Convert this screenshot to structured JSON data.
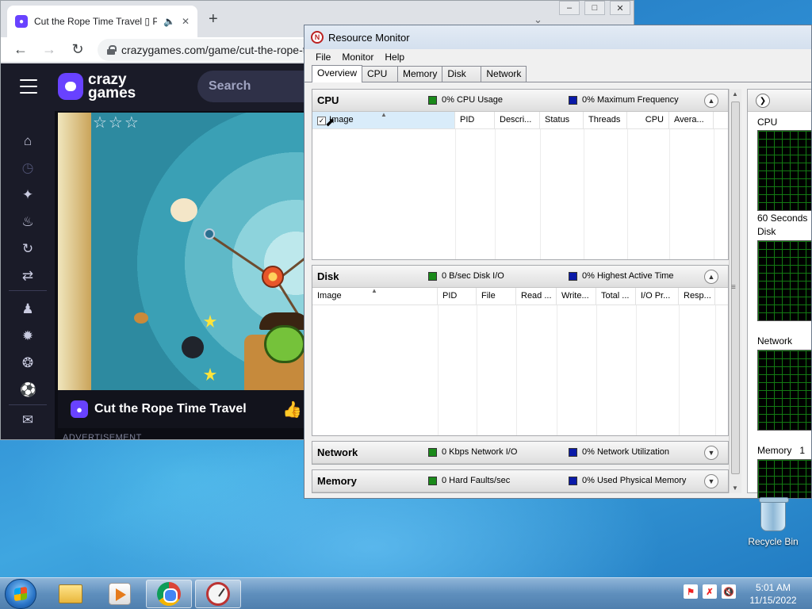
{
  "chrome": {
    "tab_title": "Cut the Rope Time Travel ▯ P",
    "url": "crazygames.com/game/cut-the-rope-t",
    "newtab_symbol": "+",
    "close_symbol": "✕"
  },
  "site": {
    "logo_line1": "crazy",
    "logo_line2": "games",
    "search_placeholder": "Search",
    "game_title": "Cut the Rope Time Travel",
    "stars": "☆☆☆",
    "advertisement": "ADVERTISEMENT"
  },
  "resmon": {
    "title": "Resource Monitor",
    "menu": [
      "File",
      "Monitor",
      "Help"
    ],
    "tabs": [
      "Overview",
      "CPU",
      "Memory",
      "Disk",
      "Network"
    ],
    "cpu": {
      "name": "CPU",
      "stat1": "0% CPU Usage",
      "stat2": "0% Maximum Frequency",
      "columns": [
        "Image",
        "PID",
        "Descri...",
        "Status",
        "Threads",
        "CPU",
        "Avera..."
      ]
    },
    "disk": {
      "name": "Disk",
      "stat1": "0 B/sec Disk I/O",
      "stat2": "0% Highest Active Time",
      "columns": [
        "Image",
        "PID",
        "File",
        "Read ...",
        "Write...",
        "Total ...",
        "I/O Pr...",
        "Resp..."
      ]
    },
    "network": {
      "name": "Network",
      "stat1": "0 Kbps Network I/O",
      "stat2": "0% Network Utilization"
    },
    "memory": {
      "name": "Memory",
      "stat1": "0 Hard Faults/sec",
      "stat2": "0% Used Physical Memory"
    },
    "graphs": {
      "cpu_label": "CPU",
      "seconds_label": "60 Seconds",
      "disk_label": "Disk",
      "network_label": "Network",
      "memory_label": "Memory",
      "memory_value": "1"
    },
    "stat_colors": {
      "primary": "#1a8a1a",
      "secondary": "#0a1aa8"
    }
  },
  "desktop": {
    "recycle_bin": "Recycle Bin"
  },
  "taskbar": {
    "time": "5:01 AM",
    "date": "11/15/2022"
  }
}
